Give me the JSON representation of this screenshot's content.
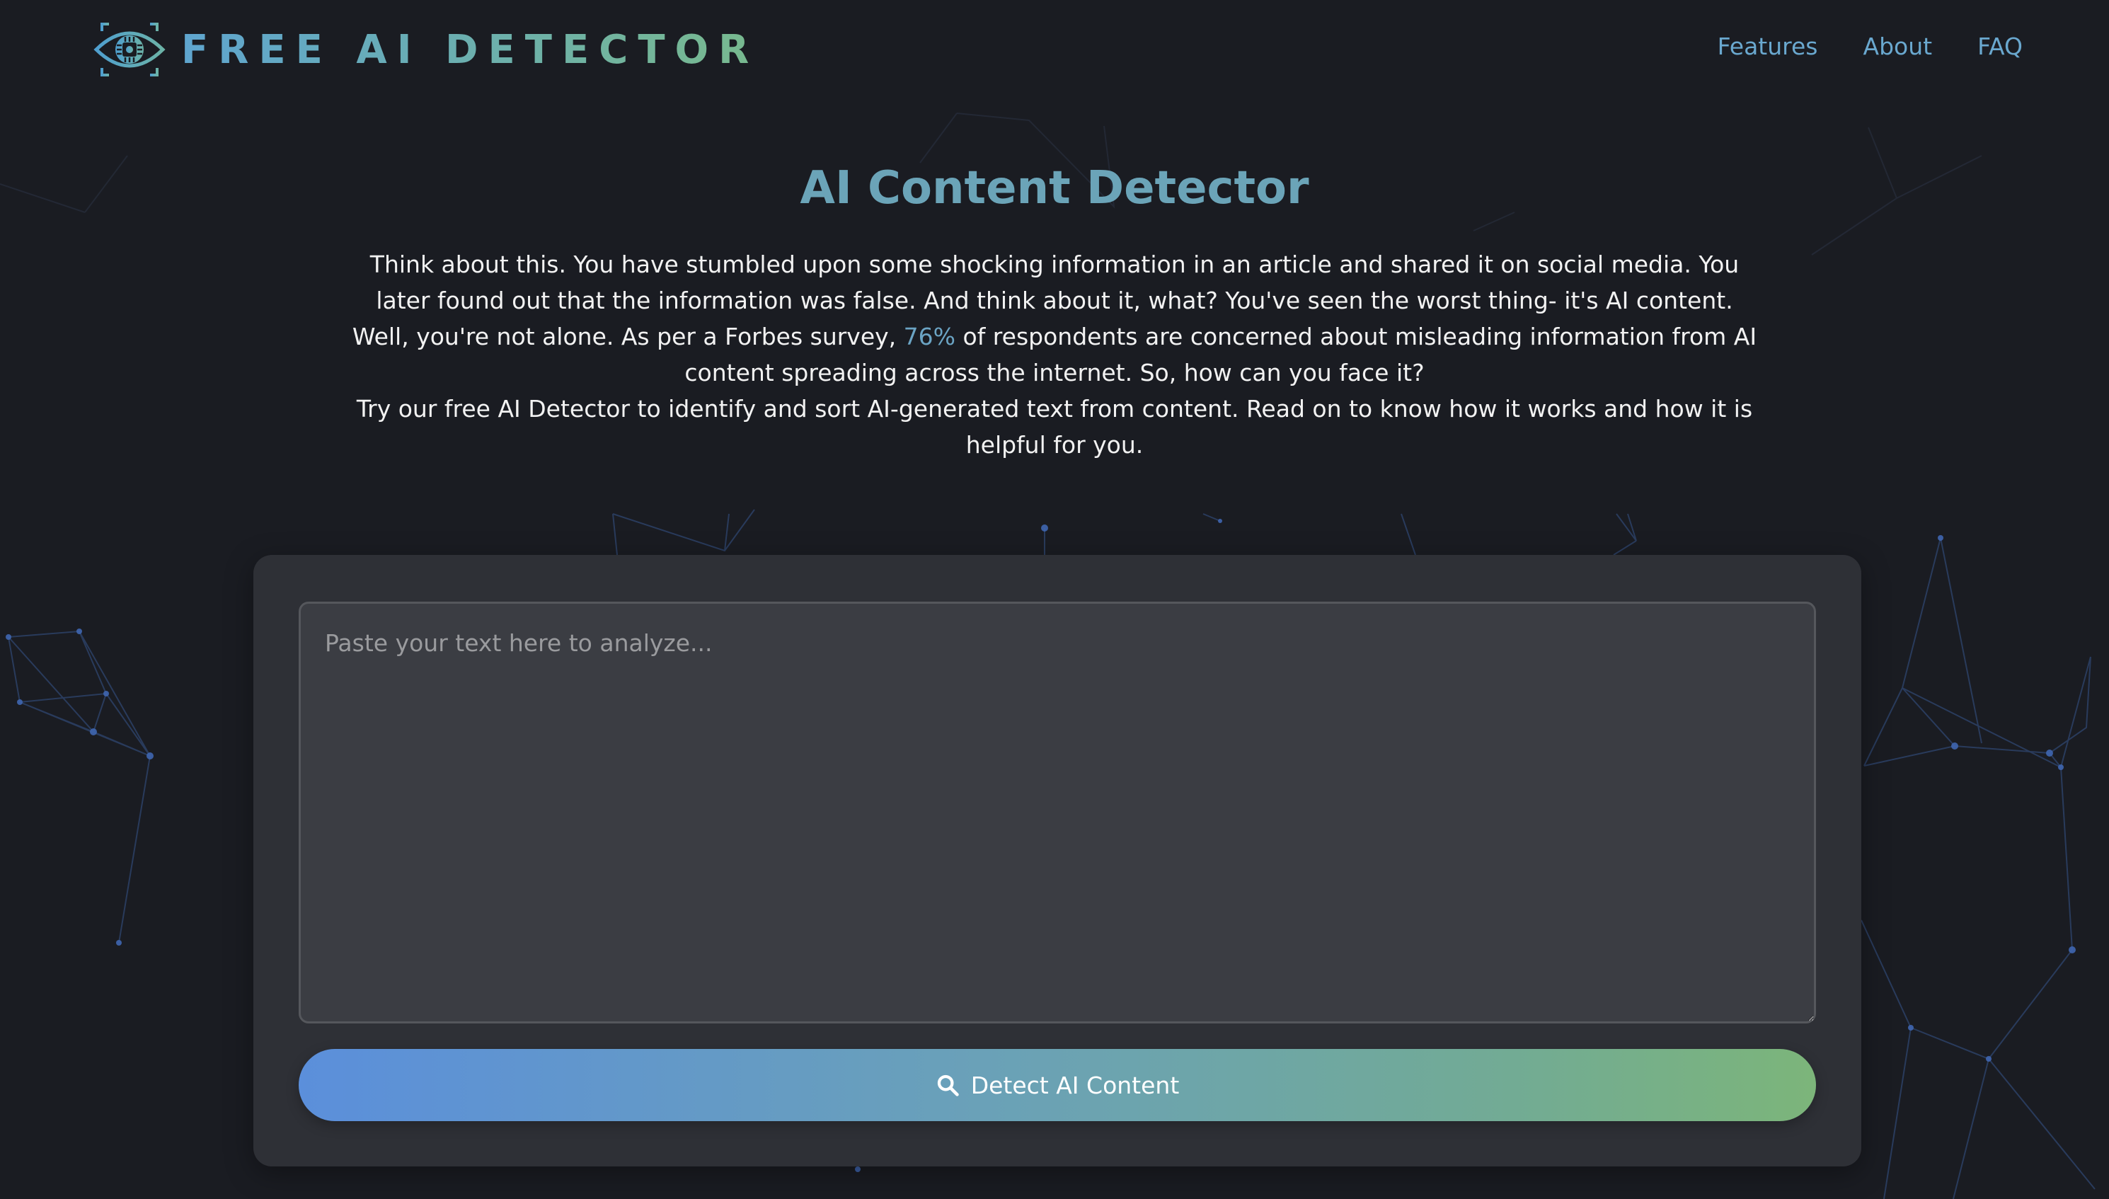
{
  "header": {
    "logo_text": "FREE AI DETECTOR",
    "logo_icon": "eye-chip-icon",
    "nav": [
      {
        "label": "Features"
      },
      {
        "label": "About"
      },
      {
        "label": "FAQ"
      }
    ]
  },
  "intro": {
    "title": "AI Content Detector",
    "p1": "Think about this. You have stumbled upon some shocking information in an article and shared it on social media. You later found out that the information was false. And think about it, what? You've seen the worst thing- it's AI content.",
    "p2_before": "Well, you're not alone. As per a Forbes survey, ",
    "p2_highlight": "76%",
    "p2_after": " of respondents are concerned about misleading information from AI content spreading across the internet. So, how can you face it?",
    "p3": "Try our free AI Detector to identify and sort AI-generated text from content. Read on to know how it works and how it is helpful for you."
  },
  "detector": {
    "placeholder": "Paste your text here to analyze...",
    "value": "",
    "button_label": "Detect AI Content",
    "button_icon": "search-icon"
  },
  "colors": {
    "background": "#1a1c22",
    "title": "#6ba4b8",
    "nav_link": "#6aa8cf",
    "card": "#2e3036",
    "textarea": "#3b3d43",
    "button_gradient_start": "#5b8fdb",
    "button_gradient_end": "#7cb57a",
    "highlight": "#6ba4c4"
  }
}
